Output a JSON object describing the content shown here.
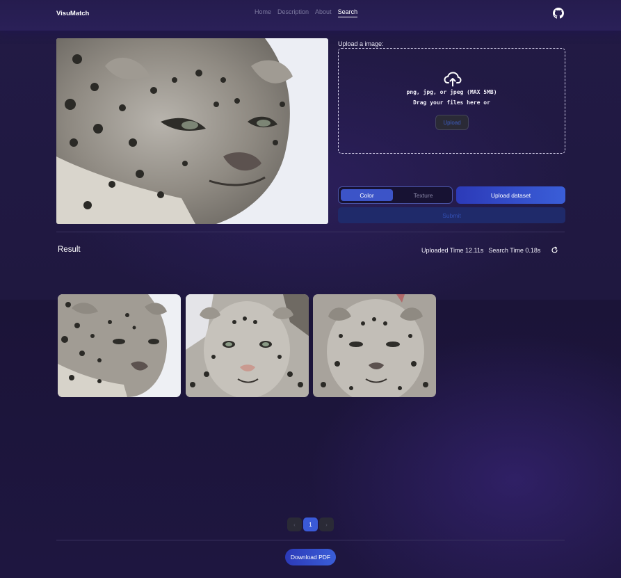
{
  "navbar": {
    "brand": "VisuMatch",
    "links": [
      {
        "label": "Home",
        "active": false
      },
      {
        "label": "Description",
        "active": false
      },
      {
        "label": "About",
        "active": false
      },
      {
        "label": "Search",
        "active": true
      }
    ],
    "github_icon": "github-icon"
  },
  "upload": {
    "label": "Upload a image:",
    "icon": "cloud-upload-icon",
    "formats": "png, jpg, or jpeg (MAX 5MB)",
    "hint": "Drag your files here or",
    "button": "Upload"
  },
  "controls": {
    "toggle": {
      "color": "Color",
      "texture": "Texture",
      "selected": "Color"
    },
    "upload_dataset": "Upload dataset",
    "submit": "Submit"
  },
  "result": {
    "title": "Result",
    "uploaded_time": "Uploaded Time 12.11s",
    "search_time": "Search Time 0.18s",
    "refresh_icon": "refresh-icon",
    "items": [
      "snow-leopard-1",
      "snow-leopard-2",
      "snow-leopard-3"
    ]
  },
  "pagination": {
    "prev": "‹",
    "current": "1",
    "next": "›"
  },
  "footer": {
    "download": "Download PDF"
  },
  "colors": {
    "accent": "#3a5ad8",
    "background": "#1f1840",
    "navbar": "#2a2058"
  }
}
